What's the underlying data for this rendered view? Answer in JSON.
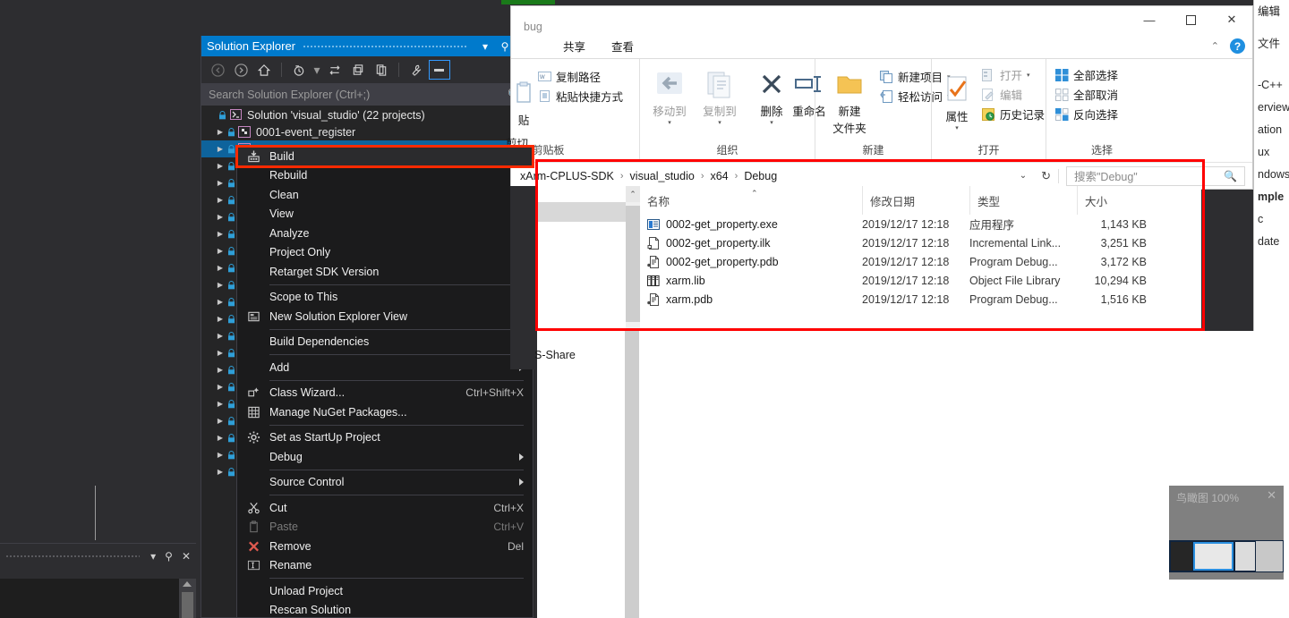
{
  "vs": {
    "solution_explorer": {
      "title": "Solution Explorer",
      "toolbar_icons": [
        "back-icon",
        "forward-icon",
        "home-icon",
        "pending-changes-icon",
        "sync-icon",
        "collapse-all-icon",
        "show-all-files-icon",
        "properties-icon",
        "preview-icon"
      ],
      "search_placeholder": "Search Solution Explorer (Ctrl+;)",
      "root_label": "Solution 'visual_studio' (22 projects)",
      "projects": [
        "0001-event_register",
        "",
        "",
        "",
        "",
        "",
        "",
        "",
        "",
        "",
        "",
        "",
        "",
        "",
        "",
        "",
        "",
        "",
        "",
        "",
        ""
      ],
      "window_buttons": [
        "chevron-down-icon",
        "pin-icon",
        "close-icon"
      ]
    },
    "bottom_dock": {
      "buttons": [
        "chevron-down-icon",
        "pin-icon",
        "close-icon"
      ]
    },
    "context_menu": {
      "highlighted": "Build",
      "items": [
        {
          "label": "Build",
          "icon": "build-icon",
          "shortcut": "",
          "submenu": false,
          "disabled": false,
          "highlight": true
        },
        {
          "label": "Rebuild",
          "icon": "",
          "shortcut": "",
          "submenu": false,
          "disabled": false
        },
        {
          "label": "Clean",
          "icon": "",
          "shortcut": "",
          "submenu": false,
          "disabled": false
        },
        {
          "label": "View",
          "icon": "",
          "shortcut": "",
          "submenu": true,
          "disabled": false
        },
        {
          "label": "Analyze",
          "icon": "",
          "shortcut": "",
          "submenu": true,
          "disabled": false
        },
        {
          "label": "Project Only",
          "icon": "",
          "shortcut": "",
          "submenu": true,
          "disabled": false
        },
        {
          "label": "Retarget SDK Version",
          "icon": "",
          "shortcut": "",
          "submenu": false,
          "disabled": false
        },
        {
          "separator": true
        },
        {
          "label": "Scope to This",
          "icon": "",
          "shortcut": "",
          "submenu": false,
          "disabled": false
        },
        {
          "label": "New Solution Explorer View",
          "icon": "new-view-icon",
          "shortcut": "",
          "submenu": false,
          "disabled": false
        },
        {
          "separator": true
        },
        {
          "label": "Build Dependencies",
          "icon": "",
          "shortcut": "",
          "submenu": true,
          "disabled": false
        },
        {
          "separator": true
        },
        {
          "label": "Add",
          "icon": "",
          "shortcut": "",
          "submenu": true,
          "disabled": false
        },
        {
          "separator": true
        },
        {
          "label": "Class Wizard...",
          "icon": "class-wizard-icon",
          "shortcut": "Ctrl+Shift+X",
          "submenu": false,
          "disabled": false
        },
        {
          "label": "Manage NuGet Packages...",
          "icon": "nuget-icon",
          "shortcut": "",
          "submenu": false,
          "disabled": false
        },
        {
          "separator": true
        },
        {
          "label": "Set as StartUp Project",
          "icon": "gear-icon",
          "shortcut": "",
          "submenu": false,
          "disabled": false
        },
        {
          "label": "Debug",
          "icon": "",
          "shortcut": "",
          "submenu": true,
          "disabled": false
        },
        {
          "separator": true
        },
        {
          "label": "Source Control",
          "icon": "",
          "shortcut": "",
          "submenu": true,
          "disabled": false
        },
        {
          "separator": true
        },
        {
          "label": "Cut",
          "icon": "scissors-icon",
          "shortcut": "Ctrl+X",
          "submenu": false,
          "disabled": false
        },
        {
          "label": "Paste",
          "icon": "clipboard-icon",
          "shortcut": "Ctrl+V",
          "submenu": false,
          "disabled": true
        },
        {
          "label": "Remove",
          "icon": "remove-x-icon",
          "shortcut": "Del",
          "submenu": false,
          "disabled": false
        },
        {
          "label": "Rename",
          "icon": "rename-icon",
          "shortcut": "",
          "submenu": false,
          "disabled": false
        },
        {
          "separator": true
        },
        {
          "label": "Unload Project",
          "icon": "",
          "shortcut": "",
          "submenu": false,
          "disabled": false
        },
        {
          "label": "Rescan Solution",
          "icon": "",
          "shortcut": "",
          "submenu": false,
          "disabled": false
        }
      ]
    },
    "minimap": {
      "title": "鸟瞰图 100%",
      "close": "✕"
    },
    "right_panel": {
      "menu_items": [
        "编辑"
      ],
      "file_label": "文件",
      "lines": [
        "-C++",
        "erview",
        "ation",
        "ux",
        "ndows",
        "mple",
        "c",
        "date"
      ]
    }
  },
  "explorer": {
    "window_title": "bug",
    "window_controls": {
      "minimize": "—",
      "maximize": "▫",
      "close": "✕"
    },
    "ribbon_tabs": [
      "共享",
      "查看"
    ],
    "help_button": "?",
    "collapse_ribbon": "⌃",
    "groups": [
      {
        "name": "剪贴板",
        "label": "剪贴板",
        "commands": [
          "贴",
          "剪切",
          "复制路径",
          "粘贴快捷方式"
        ]
      },
      {
        "name": "组织",
        "label": "组织",
        "commands": [
          "移动到",
          "复制到",
          "删除",
          "重命名"
        ]
      },
      {
        "name": "新建",
        "label": "新建",
        "commands": [
          "新建文件夹",
          "新建项目",
          "轻松访问"
        ]
      },
      {
        "name": "打开",
        "label": "打开",
        "commands": [
          "属性",
          "打开",
          "编辑",
          "历史记录"
        ]
      },
      {
        "name": "选择",
        "label": "选择",
        "commands": [
          "全部选择",
          "全部取消",
          "反向选择"
        ]
      }
    ],
    "clipboard": {
      "paste_label": "贴",
      "cut_label": "剪切",
      "copy_path": "复制路径",
      "paste_shortcut": "粘贴快捷方式",
      "group_label": "剪贴板"
    },
    "organize": {
      "move_to": "移动到",
      "copy_to": "复制到",
      "delete": "删除",
      "rename": "重命名",
      "group_label": "组织"
    },
    "new": {
      "new_folder_l1": "新建",
      "new_folder_l2": "文件夹",
      "new_item": "新建项目",
      "easy_access": "轻松访问",
      "group_label": "新建"
    },
    "open": {
      "properties": "属性",
      "open": "打开",
      "edit": "编辑",
      "history": "历史记录",
      "group_label": "打开"
    },
    "select": {
      "select_all": "全部选择",
      "select_none": "全部取消",
      "invert": "反向选择",
      "group_label": "选择"
    },
    "address": {
      "breadcrumbs": [
        "xArm-CPLUS-SDK",
        "visual_studio",
        "x64",
        "Debug"
      ],
      "dropdown": "⌄",
      "refresh": "↻",
      "search_placeholder": "搜索\"Debug\""
    },
    "columns": [
      "名称",
      "修改日期",
      "类型",
      "大小"
    ],
    "files": [
      {
        "icon": "exe-icon",
        "name": "0002-get_property.exe",
        "date": "2019/12/17 12:18",
        "type": "应用程序",
        "size": "1,143 KB"
      },
      {
        "icon": "ilk-icon",
        "name": "0002-get_property.ilk",
        "date": "2019/12/17 12:18",
        "type": "Incremental Link...",
        "size": "3,251 KB"
      },
      {
        "icon": "pdb-icon",
        "name": "0002-get_property.pdb",
        "date": "2019/12/17 12:18",
        "type": "Program Debug...",
        "size": "3,172 KB"
      },
      {
        "icon": "lib-icon",
        "name": "xarm.lib",
        "date": "2019/12/17 12:18",
        "type": "Object File Library",
        "size": "10,294 KB"
      },
      {
        "icon": "pdb-icon",
        "name": "xarm.pdb",
        "date": "2019/12/17 12:18",
        "type": "Program Debug...",
        "size": "1,516 KB"
      }
    ],
    "nav_label": "S-Share",
    "highlight_color": "#ff0000"
  },
  "colors": {
    "vs_accent": "#007acc",
    "vs_bg": "#2d2d30",
    "vs_panel": "#252526",
    "menu_bg": "#1b1b1c",
    "selection": "#0e639c",
    "red_highlight": "#ff0000"
  }
}
